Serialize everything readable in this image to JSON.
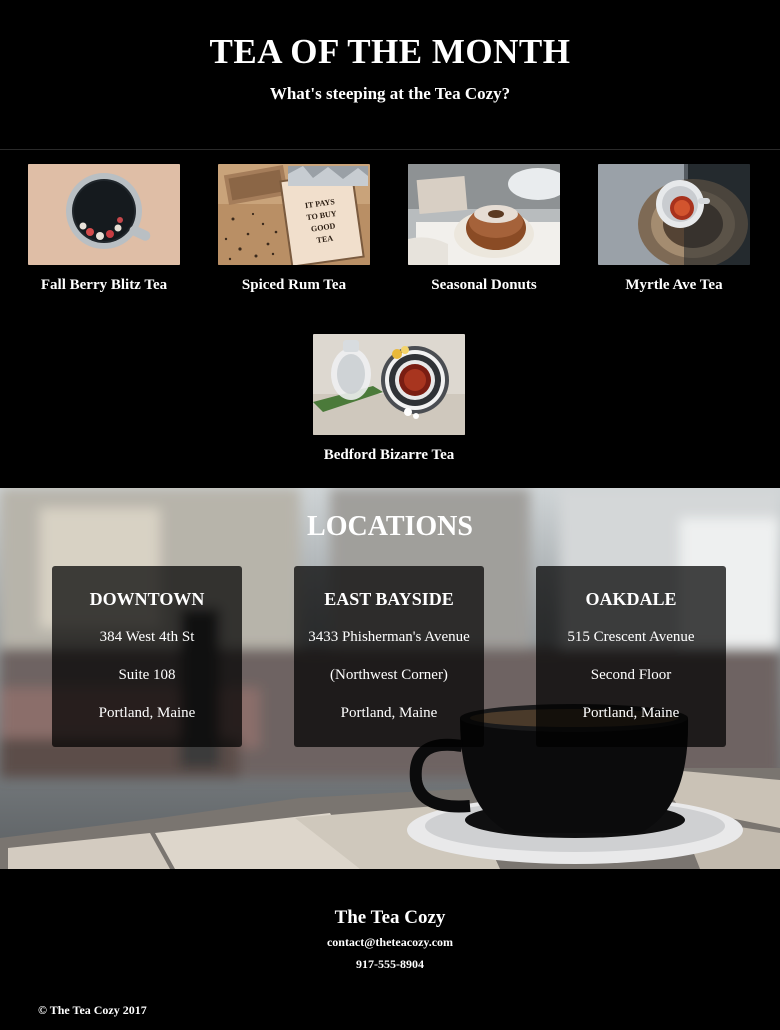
{
  "header": {
    "title": "TEA OF THE MONTH",
    "subtitle": "What's steeping at the Tea Cozy?"
  },
  "teas": [
    {
      "name": "Fall Berry Blitz Tea",
      "image": "berry-tea-cup-photo"
    },
    {
      "name": "Spiced Rum Tea",
      "image": "spiced-rum-tea-box-photo"
    },
    {
      "name": "Seasonal Donuts",
      "image": "donut-photo"
    },
    {
      "name": "Myrtle Ave Tea",
      "image": "myrtle-tea-cup-photo"
    },
    {
      "name": "Bedford Bizarre Tea",
      "image": "bedford-tea-set-photo"
    }
  ],
  "spiced_rum_box_text": "IT PAYS TO BUY GOOD TEA",
  "locations": {
    "title": "LOCATIONS",
    "cards": [
      {
        "name": "DOWNTOWN",
        "lines": [
          "384 West 4th St",
          "Suite 108",
          "Portland, Maine"
        ]
      },
      {
        "name": "EAST BAYSIDE",
        "lines": [
          "3433 Phisherman's Avenue",
          "(Northwest Corner)",
          "Portland, Maine"
        ]
      },
      {
        "name": "OAKDALE",
        "lines": [
          "515 Crescent Avenue",
          "Second Floor",
          "Portland, Maine"
        ]
      }
    ]
  },
  "footer": {
    "brand": "The Tea Cozy",
    "email": "contact@theteacozy.com",
    "phone": "917-555-8904",
    "copyright": "© The Tea Cozy 2017"
  }
}
